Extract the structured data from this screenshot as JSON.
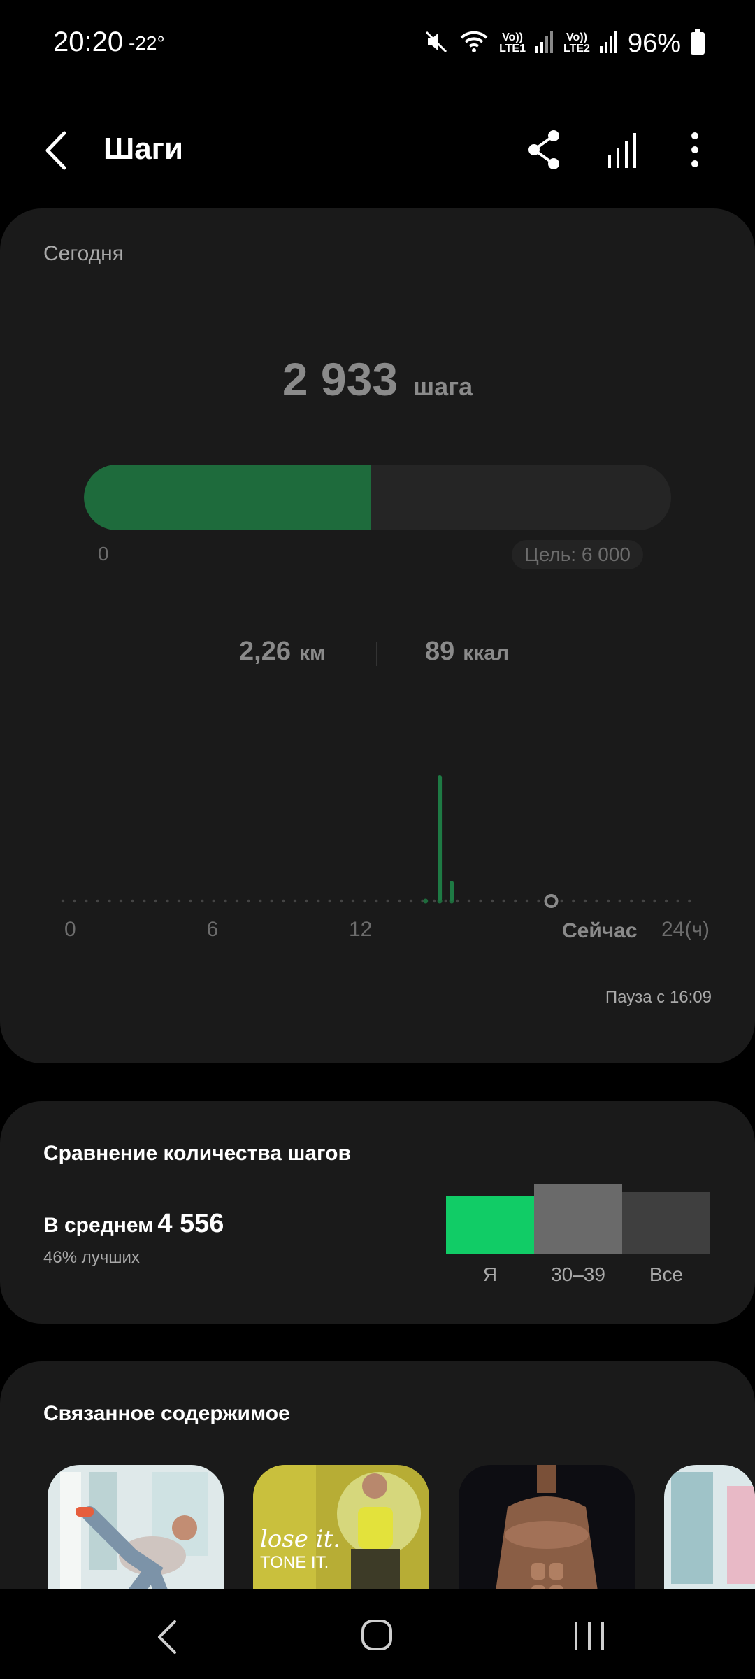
{
  "status_bar": {
    "time": "20:20",
    "temperature": "-22°",
    "lte1": "Vo))\nLTE1",
    "lte2": "Vo))\nLTE2",
    "battery": "96%",
    "icons": [
      "mute-icon",
      "wifi-icon",
      "signal-icon",
      "battery-icon"
    ]
  },
  "app_bar": {
    "title": "Шаги",
    "icons": [
      "back-arrow-icon",
      "share-icon",
      "bar-chart-icon",
      "more-vert-icon"
    ]
  },
  "today": {
    "label": "Сегодня",
    "steps": "2 933",
    "steps_unit": "шага",
    "progress_fraction": 0.489,
    "progress_min": "0",
    "goal": "Цель: 6 000",
    "distance": "2,26",
    "distance_unit": "км",
    "calories": "89",
    "calories_unit": "ккал",
    "axis_labels": [
      "0",
      "6",
      "12",
      "24(ч)"
    ],
    "now_label": "Сейчас",
    "pause": "Пауза с 16:09",
    "hourly_bars": [
      {
        "hour": 15.6,
        "relative": 1.0
      },
      {
        "hour": 16.1,
        "relative": 0.16
      }
    ],
    "now_hour": 20.3
  },
  "compare": {
    "title": "Сравнение количества шагов",
    "avg_label": "В среднем",
    "avg_value": "4 556",
    "better": "46% лучших",
    "bars": [
      {
        "label": "Я",
        "relative": 0.82,
        "color": "#11cc66"
      },
      {
        "label": "30–39",
        "relative": 1.0,
        "color": "#6a6a6a"
      },
      {
        "label": "Все",
        "relative": 0.88,
        "color": "#3f3f3f"
      }
    ]
  },
  "related": {
    "title": "Связанное содержимое",
    "thumb2_text1": "lose it.",
    "thumb2_text2": "TONE IT."
  },
  "colors": {
    "accent_green": "#11cc66",
    "dark_green": "#1e6b3c",
    "card_bg": "#1a1a1a"
  }
}
